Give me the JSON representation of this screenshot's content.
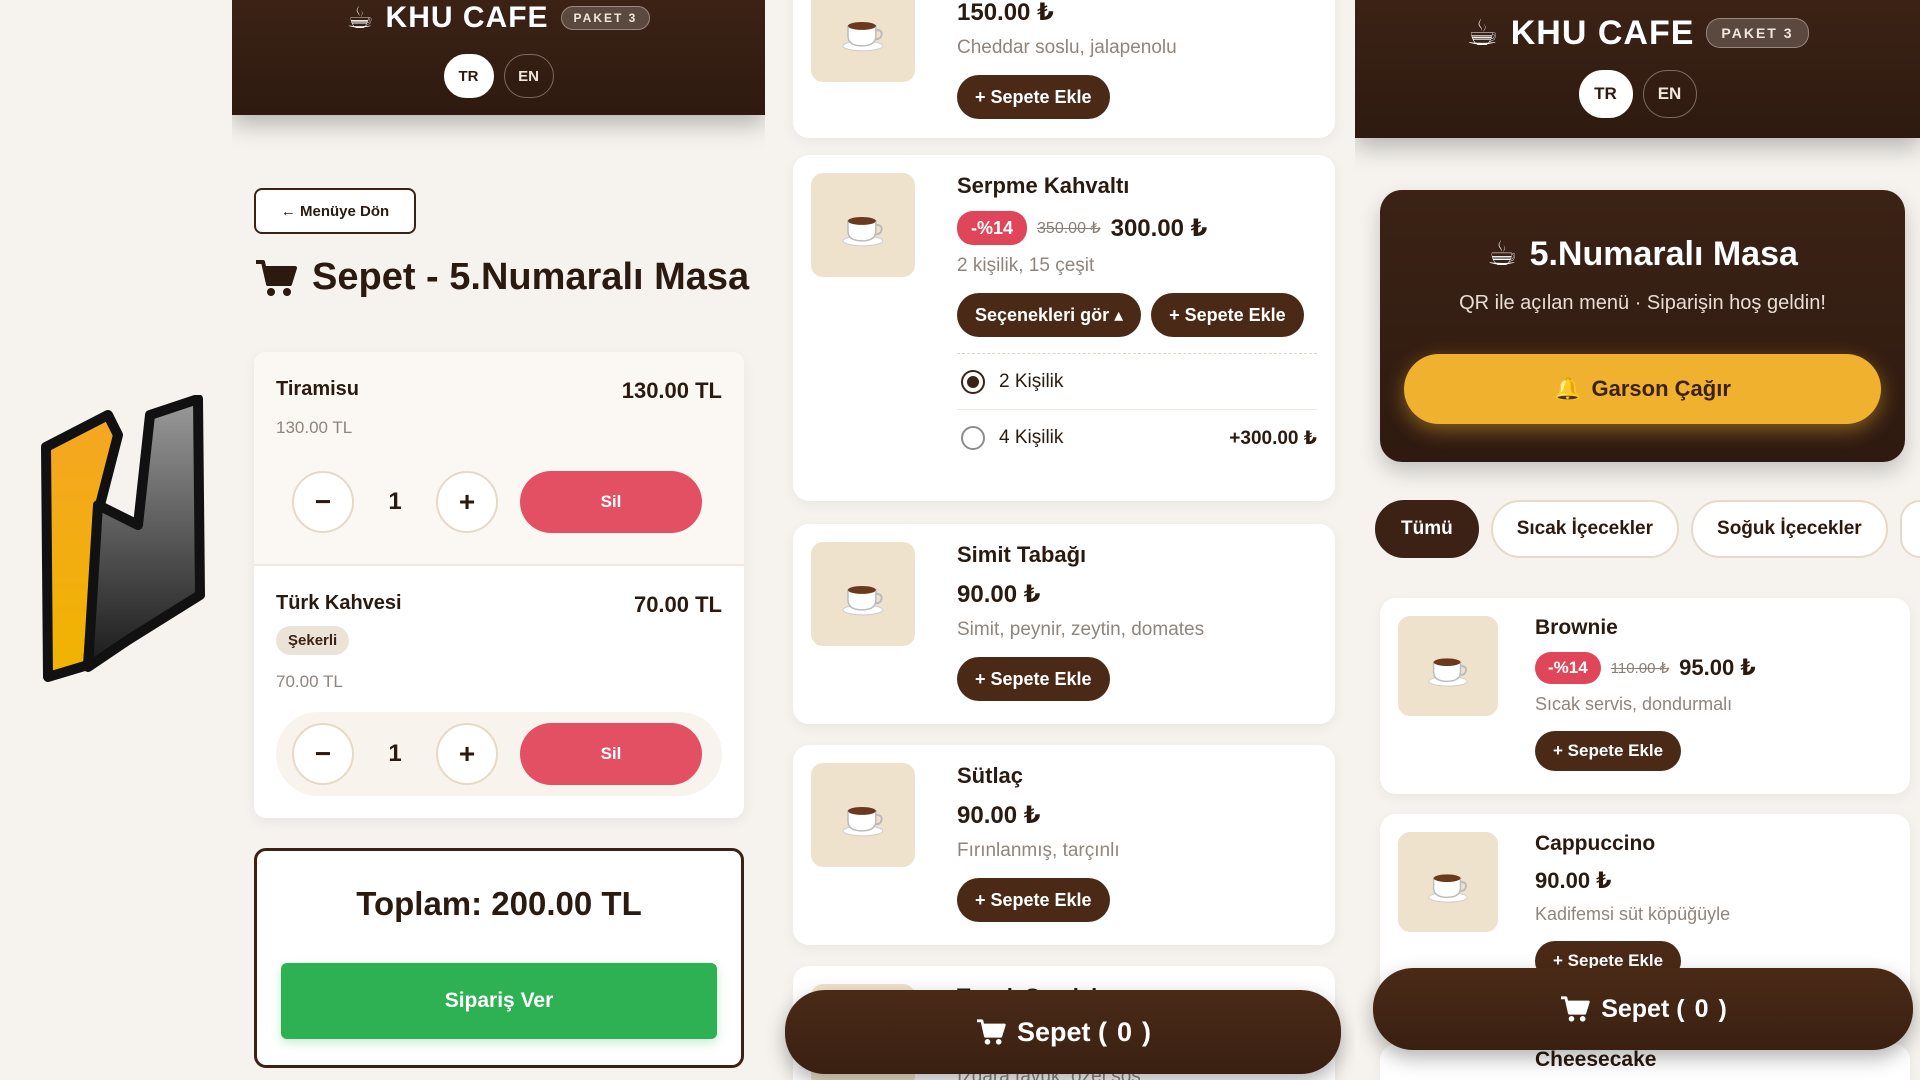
{
  "brand": {
    "name": "KHU CAFE",
    "package": "PAKET 3",
    "lang_tr": "TR",
    "lang_en": "EN"
  },
  "cart_page": {
    "back_label": "← Menüye Dön",
    "title": "Sepet - 5.Numaralı Masa",
    "items": [
      {
        "name": "Tiramisu",
        "total": "130.00 TL",
        "unit": "130.00 TL",
        "option": "",
        "qty": "1",
        "minus": "−",
        "plus": "+",
        "delete": "Sil"
      },
      {
        "name": "Türk Kahvesi",
        "total": "70.00 TL",
        "unit": "70.00 TL",
        "option": "Şekerli",
        "qty": "1",
        "minus": "−",
        "plus": "+",
        "delete": "Sil"
      }
    ],
    "total": "Toplam: 200.00 TL",
    "order_button": "Sipariş Ver"
  },
  "product_list": {
    "add_label": "+ Sepete Ekle",
    "options_label": "Seçenekleri gör ▴",
    "products": [
      {
        "name": "",
        "price": "150.00 ₺",
        "desc": "Cheddar soslu, jalapenolu"
      },
      {
        "name": "Serpme Kahvaltı",
        "discount": "-%14",
        "old_price": "350.00 ₺",
        "price": "300.00 ₺",
        "desc": "2 kişilik, 15 çeşit",
        "options": [
          {
            "label": "2 Kişilik",
            "extra": "",
            "selected": true
          },
          {
            "label": "4 Kişilik",
            "extra": "+300.00 ₺",
            "selected": false
          }
        ]
      },
      {
        "name": "Simit Tabağı",
        "price": "90.00 ₺",
        "desc": "Simit, peynir, zeytin, domates"
      },
      {
        "name": "Sütlaç",
        "price": "90.00 ₺",
        "desc": "Fırınlanmış, tarçınlı"
      },
      {
        "name": "Tavuk Sandviç",
        "desc": "Izgara tavuk, özel sos"
      }
    ],
    "cart_bar": {
      "label": "Sepet (",
      "count": "0",
      "close": ")"
    }
  },
  "menu_page": {
    "table_title": "5.Numaralı Masa",
    "table_sub": "QR ile açılan menü · Siparişin hoş geldin!",
    "waiter_button": "Garson Çağır",
    "categories": [
      "Tümü",
      "Sıcak İçecekler",
      "Soğuk İçecekler"
    ],
    "items": [
      {
        "name": "Brownie",
        "discount": "-%14",
        "old_price": "110.00 ₺",
        "price": "95.00 ₺",
        "desc": "Sıcak servis, dondurmalı"
      },
      {
        "name": "Cappuccino",
        "price": "90.00 ₺",
        "desc": "Kadifemsi süt köpüğüyle"
      },
      {
        "name": "Cheesecake"
      }
    ],
    "cart_bar": {
      "label": "Sepet (",
      "count": "0",
      "close": ")"
    }
  },
  "icons": {
    "cup": "coffee-cup-icon",
    "cart": "shopping-cart-icon",
    "bell": "bell-icon",
    "logo": "app-logo"
  },
  "colors": {
    "brand_dark": "#3b2215",
    "accent_yellow": "#f0b22e",
    "discount_red": "#e0465a",
    "delete_red": "#e34f63",
    "order_green": "#2db152",
    "cream": "#efe2cd"
  }
}
